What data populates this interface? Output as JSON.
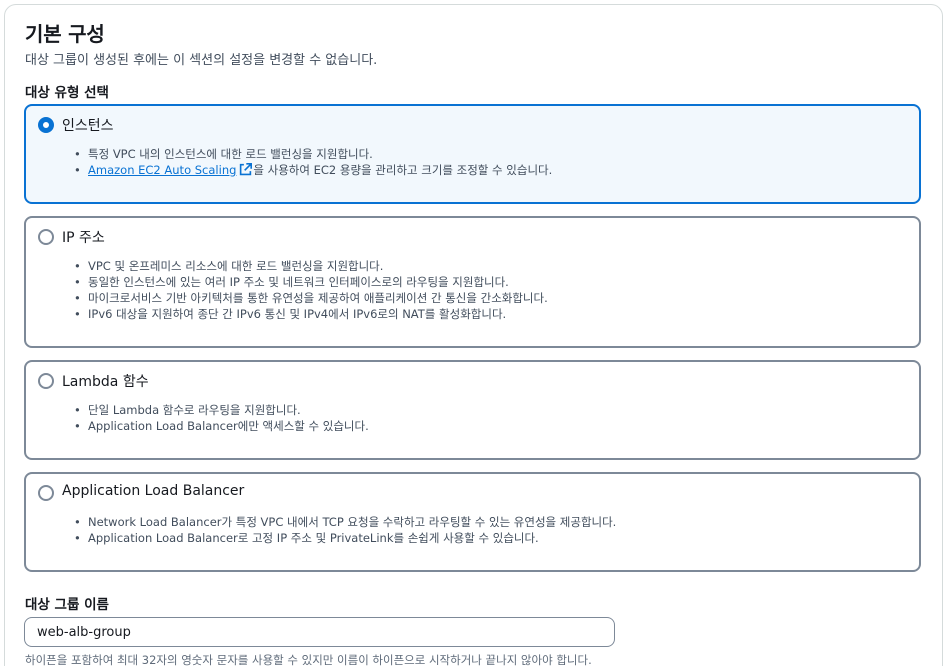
{
  "section": {
    "title": "기본 구성",
    "description": "대상 그룹이 생성된 후에는 이 섹션의 설정을 변경할 수 없습니다.",
    "target_type_label": "대상 유형 선택"
  },
  "options": [
    {
      "label": "인스턴스",
      "selected": true,
      "bullets": [
        "특정 VPC 내의 인스턴스에 대한 로드 밸런싱을 지원합니다."
      ],
      "link_text": "Amazon EC2 Auto Scaling",
      "link_suffix": "을 사용하여 EC2 용량을 관리하고 크기를 조정할 수 있습니다."
    },
    {
      "label": "IP 주소",
      "selected": false,
      "bullets": [
        "VPC 및 온프레미스 리소스에 대한 로드 밸런싱을 지원합니다.",
        "동일한 인스턴스에 있는 여러 IP 주소 및 네트워크 인터페이스로의 라우팅을 지원합니다.",
        "마이크로서비스 기반 아키텍처를 통한 유연성을 제공하여 애플리케이션 간 통신을 간소화합니다.",
        "IPv6 대상을 지원하여 종단 간 IPv6 통신 및 IPv4에서 IPv6로의 NAT를 활성화합니다."
      ]
    },
    {
      "label": "Lambda 함수",
      "selected": false,
      "bullets": [
        "단일 Lambda 함수로 라우팅을 지원합니다.",
        "Application Load Balancer에만 액세스할 수 있습니다."
      ]
    },
    {
      "label": "Application Load Balancer",
      "selected": false,
      "bullets": [
        "Network Load Balancer가 특정 VPC 내에서 TCP 요청을 수락하고 라우팅할 수 있는 유연성을 제공합니다.",
        "Application Load Balancer로 고정 IP 주소 및 PrivateLink를 손쉽게 사용할 수 있습니다."
      ]
    }
  ],
  "target_group_name": {
    "label": "대상 그룹 이름",
    "value": "web-alb-group",
    "hint": "하이픈을 포함하여 최대 32자의 영숫자 문자를 사용할 수 있지만 이름이 하이픈으로 시작하거나 끝나지 않아야 합니다."
  },
  "colors": {
    "accent": "#0972d3",
    "selected_bg": "#f2f8fd",
    "border": "#7d8998",
    "text": "#16191f",
    "secondary_text": "#414d5c"
  },
  "icons": {
    "external_link": "external-link-icon"
  }
}
